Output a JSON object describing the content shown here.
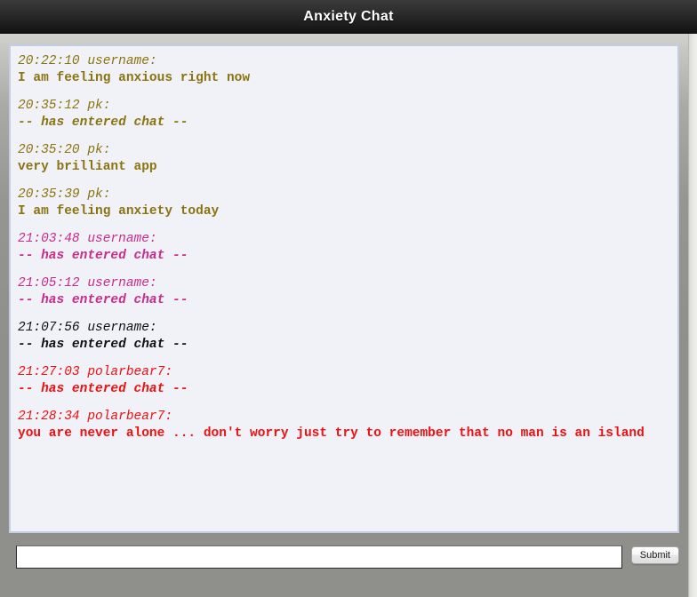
{
  "window": {
    "title": "Anxiety Chat"
  },
  "colors": {
    "olive": "#8a7410",
    "magenta": "#c82c8c",
    "black": "#111111",
    "red": "#ee1111",
    "panel_background": "#f1f1f8",
    "panel_border": "#c3cee0",
    "page_background": "#8f8f8b",
    "titlebar_background": "#1d1d1d"
  },
  "chat": {
    "messages": [
      {
        "meta": "20:22:10 username:",
        "body": "I am feeling anxious right now",
        "color": "#8a7410",
        "italic_body": false
      },
      {
        "meta": "20:35:12 pk:",
        "body": "-- has entered chat --",
        "color": "#8a7410",
        "italic_body": true
      },
      {
        "meta": "20:35:20 pk:",
        "body": "very brilliant app",
        "color": "#8a7410",
        "italic_body": false
      },
      {
        "meta": "20:35:39 pk:",
        "body": "I am feeling anxiety today",
        "color": "#8a7410",
        "italic_body": false
      },
      {
        "meta": "21:03:48 username:",
        "body": "-- has entered chat --",
        "color": "#c82c8c",
        "italic_body": true
      },
      {
        "meta": "21:05:12 username:",
        "body": "-- has entered chat --",
        "color": "#c82c8c",
        "italic_body": true
      },
      {
        "meta": "21:07:56 username:",
        "body": "-- has entered chat --",
        "color": "#111111",
        "italic_body": true
      },
      {
        "meta": "21:27:03 polarbear7:",
        "body": "-- has entered chat --",
        "color": "#ee1111",
        "italic_body": true
      },
      {
        "meta": "21:28:34 polarbear7:",
        "body": "you are never alone ... don't worry just try to remember that no man is an island",
        "color": "#ee1111",
        "italic_body": false
      }
    ]
  },
  "composer": {
    "input_value": "",
    "input_placeholder": "",
    "submit_label": "Submit"
  }
}
